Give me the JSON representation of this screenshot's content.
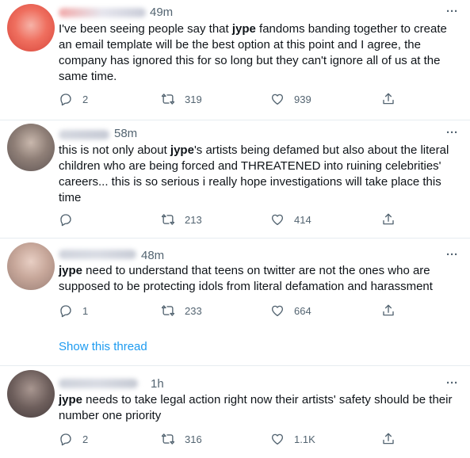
{
  "tweets": [
    {
      "time": "49m",
      "text_parts": [
        "I've been seeing people say that ",
        "jype",
        " fandoms banding together to create an email template will be the best option at this point and I agree, the company has ignored this for so long but they can't ignore all of us at the same time."
      ],
      "replies": "2",
      "retweets": "319",
      "likes": "939"
    },
    {
      "time": "58m",
      "text_parts": [
        "this is not only about ",
        "jype",
        "'s artists being defamed but also about the literal children who are being forced and THREATENED into ruining celebrities' careers... this is so serious i really hope investigations will take place this time"
      ],
      "replies": "",
      "retweets": "213",
      "likes": "414"
    },
    {
      "time": "48m",
      "text_parts": [
        "",
        "jype",
        " need to understand that teens on twitter are not the ones who are supposed to be protecting idols from literal defamation and harassment"
      ],
      "replies": "1",
      "retweets": "233",
      "likes": "664",
      "thread_link": "Show this thread"
    },
    {
      "time": "1h",
      "text_parts": [
        "",
        "jype",
        " needs to take legal action right now their artists' safety should be their number one priority"
      ],
      "replies": "2",
      "retweets": "316",
      "likes": "1.1K"
    }
  ],
  "more_glyph": "···",
  "colors": {
    "text": "#0f1419",
    "secondary": "#536471",
    "link": "#1d9bf0",
    "divider": "#e6ecf0"
  }
}
